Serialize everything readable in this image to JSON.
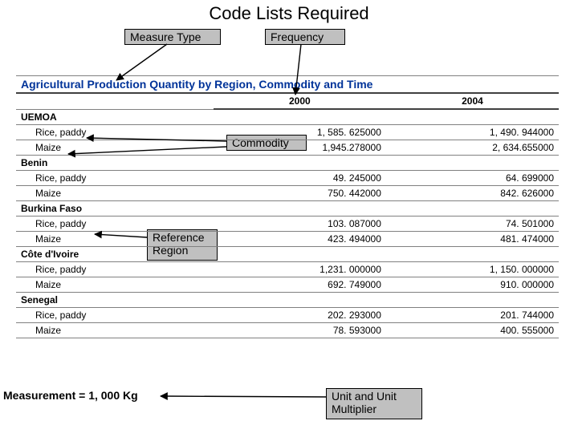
{
  "title": "Code Lists Required",
  "labels": {
    "measure_type": "Measure Type",
    "frequency": "Frequency",
    "commodity": "Commodity",
    "reference_region": "Reference\nRegion",
    "unit_multiplier": "Unit and Unit\nMultiplier"
  },
  "footnote": "Measurement = 1, 000 Kg",
  "table": {
    "title": "Agricultural Production Quantity by Region, Commodity and Time",
    "years": [
      "2000",
      "2004"
    ],
    "regions": [
      {
        "name": "UEMOA",
        "rows": [
          {
            "commodity": "Rice, paddy",
            "v": [
              "1, 585. 625000",
              "1, 490. 944000"
            ]
          },
          {
            "commodity": "Maize",
            "v": [
              "1,945.278000",
              "2, 634.655000"
            ]
          }
        ]
      },
      {
        "name": "Benin",
        "rows": [
          {
            "commodity": "Rice, paddy",
            "v": [
              "49. 245000",
              "64. 699000"
            ]
          },
          {
            "commodity": "Maize",
            "v": [
              "750. 442000",
              "842. 626000"
            ]
          }
        ]
      },
      {
        "name": "Burkina Faso",
        "rows": [
          {
            "commodity": "Rice, paddy",
            "v": [
              "103. 087000",
              "74. 501000"
            ]
          },
          {
            "commodity": "Maize",
            "v": [
              "423. 494000",
              "481. 474000"
            ]
          }
        ]
      },
      {
        "name": "Côte d'Ivoire",
        "rows": [
          {
            "commodity": "Rice, paddy",
            "v": [
              "1,231. 000000",
              "1, 150. 000000"
            ]
          },
          {
            "commodity": "Maize",
            "v": [
              "692. 749000",
              "910. 000000"
            ]
          }
        ]
      },
      {
        "name": "Senegal",
        "rows": [
          {
            "commodity": "Rice, paddy",
            "v": [
              "202. 293000",
              "201. 744000"
            ]
          },
          {
            "commodity": "Maize",
            "v": [
              "78. 593000",
              "400. 555000"
            ]
          }
        ]
      }
    ]
  },
  "chart_data": {
    "type": "table",
    "title": "Agricultural Production Quantity by Region, Commodity and Time",
    "columns": [
      "Region",
      "Commodity",
      "2000",
      "2004"
    ],
    "unit": "1,000 Kg",
    "rows": [
      [
        "UEMOA",
        "Rice, paddy",
        1585.625,
        1490.944
      ],
      [
        "UEMOA",
        "Maize",
        1945.278,
        2634.655
      ],
      [
        "Benin",
        "Rice, paddy",
        49.245,
        64.699
      ],
      [
        "Benin",
        "Maize",
        750.442,
        842.626
      ],
      [
        "Burkina Faso",
        "Rice, paddy",
        103.087,
        74.501
      ],
      [
        "Burkina Faso",
        "Maize",
        423.494,
        481.474
      ],
      [
        "Côte d'Ivoire",
        "Rice, paddy",
        1231.0,
        1150.0
      ],
      [
        "Côte d'Ivoire",
        "Maize",
        692.749,
        910.0
      ],
      [
        "Senegal",
        "Rice, paddy",
        202.293,
        201.744
      ],
      [
        "Senegal",
        "Maize",
        78.593,
        400.555
      ]
    ]
  }
}
